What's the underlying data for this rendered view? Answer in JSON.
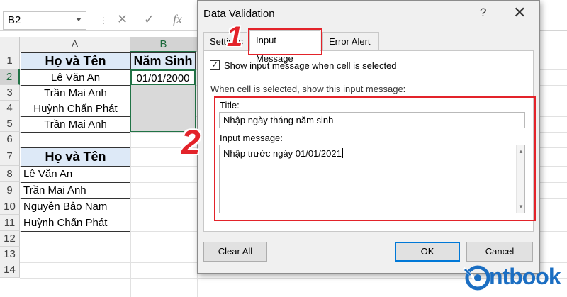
{
  "formula_bar": {
    "name_box": "B2",
    "cancel_icon": "✕",
    "confirm_icon": "✓",
    "function_icon": "fx"
  },
  "sheet": {
    "columns": [
      "A",
      "B"
    ],
    "rows": [
      "1",
      "2",
      "3",
      "4",
      "5",
      "6",
      "7",
      "8",
      "9",
      "10",
      "11",
      "12",
      "13",
      "14"
    ],
    "table1": {
      "header_a": "Họ và Tên",
      "header_b": "Năm Sinh",
      "names": [
        "Lê Văn An",
        "Trần Mai Anh",
        "Huỳnh Chấn Phát",
        "Trần Mai Anh"
      ],
      "b2_value": "01/01/2000"
    },
    "table2": {
      "header": "Họ và Tên",
      "names": [
        "Lê Văn An",
        "Trần Mai Anh",
        "Nguyễn Bảo Nam",
        "Huỳnh Chấn Phát"
      ]
    }
  },
  "dialog": {
    "title": "Data Validation",
    "help": "?",
    "close": "✕",
    "tabs": [
      "Settings",
      "Input Message",
      "Error Alert"
    ],
    "checkbox_label": "Show input message when cell is selected",
    "checkbox_checked": true,
    "group_label": "When cell is selected, show this input message:",
    "title_label": "Title:",
    "title_value": "Nhập ngày tháng năm sinh",
    "message_label": "Input message:",
    "message_value": "Nhập trước ngày 01/01/2021",
    "buttons": {
      "clear_all": "Clear All",
      "ok": "OK",
      "cancel": "Cancel"
    }
  },
  "annotations": {
    "step1": "1",
    "step2": "2"
  },
  "logo": {
    "text": "ntbook"
  },
  "colors": {
    "highlight_red": "#e3232a",
    "header_fill": "#dde9f7",
    "excel_green": "#217346",
    "logo_blue": "#1b6ec2"
  }
}
